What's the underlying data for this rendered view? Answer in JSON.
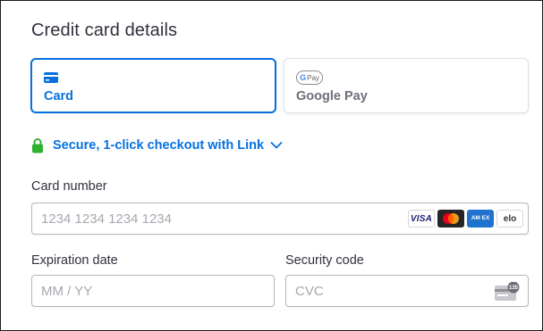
{
  "form": {
    "title": "Credit card details"
  },
  "payment_methods": [
    {
      "label": "Card",
      "icon": "card-icon",
      "selected": true
    },
    {
      "label": "Google Pay",
      "icon": "google-pay-icon",
      "badge_text": "Pay",
      "selected": false
    }
  ],
  "link_checkout": {
    "text": "Secure, 1-click checkout with Link",
    "icon": "lock-icon"
  },
  "card_number": {
    "label": "Card number",
    "placeholder": "1234 1234 1234 1234",
    "value": "",
    "brands": [
      {
        "name": "visa",
        "text": "VISA"
      },
      {
        "name": "mastercard"
      },
      {
        "name": "amex",
        "text": "AM EX"
      },
      {
        "name": "elo",
        "text": "elo"
      }
    ]
  },
  "expiration": {
    "label": "Expiration date",
    "placeholder": "MM / YY",
    "value": ""
  },
  "security_code": {
    "label": "Security code",
    "placeholder": "CVC",
    "value": "",
    "icon_text": "135"
  },
  "colors": {
    "accent": "#0570de",
    "text": "#30313d",
    "muted": "#6d6e78",
    "placeholder": "#a6a8b0",
    "lock_green": "#30b130"
  }
}
